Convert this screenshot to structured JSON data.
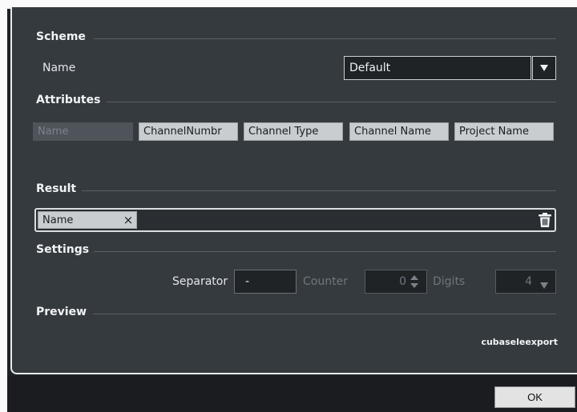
{
  "scheme": {
    "title": "Scheme",
    "name_label": "Name",
    "name_value": "Default"
  },
  "attributes": {
    "title": "Attributes",
    "items": [
      "Name",
      "ChannelNumbr",
      "Channel Type",
      "Channel Name",
      "Project Name"
    ]
  },
  "result": {
    "title": "Result",
    "tokens": [
      "Name"
    ],
    "remove_glyph": "×"
  },
  "settings": {
    "title": "Settings",
    "separator_label": "Separator",
    "separator_value": "-",
    "counter_label": "Counter",
    "counter_value": "0",
    "digits_label": "Digits",
    "digits_value": "4"
  },
  "preview": {
    "title": "Preview",
    "text": "cubaseleexport"
  },
  "footer": {
    "ok_label": "OK"
  },
  "icons": {
    "dropdown": "triangle-down-icon",
    "spinner": "up-down-stepper-icon",
    "trash": "trash-icon",
    "remove": "close-icon"
  }
}
